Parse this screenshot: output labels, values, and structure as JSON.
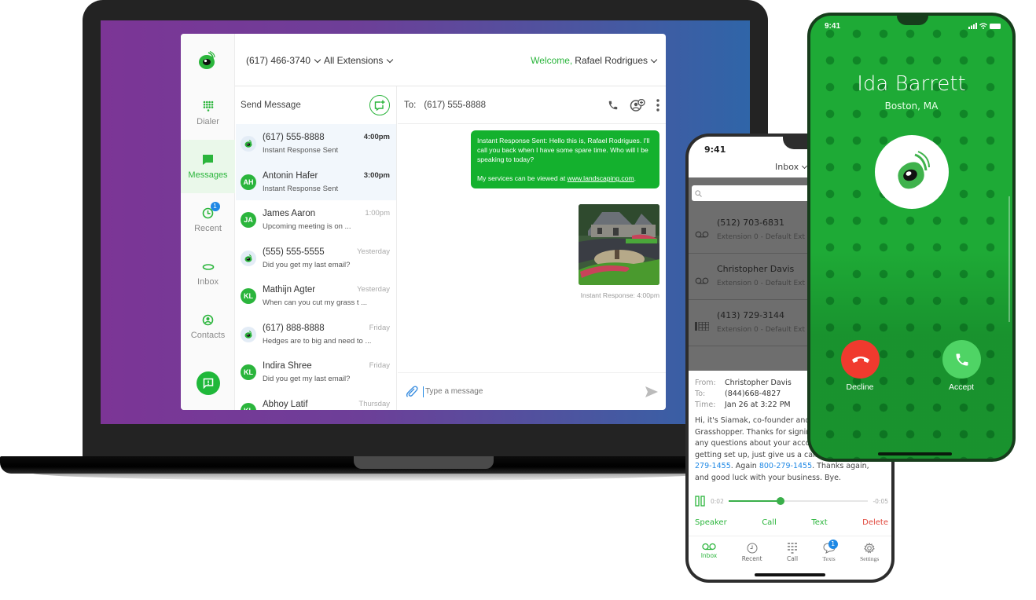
{
  "desktop_app": {
    "header": {
      "phone_number": "(617) 466-3740",
      "extensions": "All Extensions",
      "welcome_prefix": "Welcome,",
      "user_name": "Rafael Rodrigues"
    },
    "nav": [
      {
        "label": "Dialer",
        "icon": "dialpad-icon"
      },
      {
        "label": "Messages",
        "icon": "message-icon",
        "active": true
      },
      {
        "label": "Recent",
        "icon": "clock-icon",
        "badge": "1"
      },
      {
        "label": "Inbox",
        "icon": "voicemail-icon"
      },
      {
        "label": "Contacts",
        "icon": "contact-icon"
      }
    ],
    "feedback_icon": "feedback-icon",
    "list": {
      "title": "Send Message",
      "conversations": [
        {
          "avatar": "logo",
          "name": "(617) 555-8888",
          "preview": "Instant Response Sent",
          "time": "4:00pm",
          "bold_time": true,
          "selected": true
        },
        {
          "avatar": "AH",
          "name": "Antonin Hafer",
          "preview": "Instant Response Sent",
          "time": "3:00pm",
          "bold_time": true,
          "selected": true
        },
        {
          "avatar": "JA",
          "name": "James Aaron",
          "preview": "Upcoming meeting is on ...",
          "time": "1:00pm"
        },
        {
          "avatar": "logo",
          "name": "(555) 555-5555",
          "preview": "Did you get my last email?",
          "time": "Yesterday"
        },
        {
          "avatar": "KL",
          "name": "Mathijn Agter",
          "preview": "When can you cut my grass t ...",
          "time": "Yesterday"
        },
        {
          "avatar": "logo",
          "name": "(617) 888-8888",
          "preview": "Hedges are to big and need to ...",
          "time": "Friday"
        },
        {
          "avatar": "KL",
          "name": "Indira Shree",
          "preview": "Did you get my last email?",
          "time": "Friday"
        },
        {
          "avatar": "KL",
          "name": "Abhoy Latif",
          "preview": "",
          "time": "Thursday"
        }
      ]
    },
    "chat": {
      "to_label": "To:",
      "to_number": "(617) 555-8888",
      "message_text": "Instant Response Sent: Hello this is, Rafael Rodrigues. I'll call you back when I have some spare time. Who will I be speaking to today?",
      "message_services_prefix": "My services can be viewed at ",
      "message_link": "www.landscaping.com",
      "message_services_suffix": ".",
      "image_caption": "Instant Response: 4:00pm",
      "compose_placeholder": "Type a message"
    }
  },
  "inbox_phone": {
    "time": "9:41",
    "title": "Inbox",
    "items": [
      {
        "icon": "voicemail-icon",
        "title": "(512) 703-6831",
        "subtitle": "Extension 0 - Default Ext"
      },
      {
        "icon": "voicemail-icon",
        "title": "Christopher Davis",
        "subtitle": "Extension 0 - Default Ext"
      },
      {
        "icon": "fax-icon",
        "title": "(413) 729-3144",
        "subtitle": "Extension 0 - Default Ext"
      }
    ],
    "detail": {
      "from_label": "From:",
      "from": "Christopher Davis",
      "to_label": "To:",
      "to": "(844)668-4827",
      "time_label": "Time:",
      "time": "Jan 26 at 3:22 PM",
      "body_1": "Hi, it's Siamak, co-founder and CEO of Grasshopper. Thanks for signing up. If you have any questions about your account or need help getting set up, just give us a call, 24/7, at ",
      "body_link_1": "800-279-1455",
      "body_2": ". Again ",
      "body_link_2": "800-279-1455",
      "body_3": ". Thanks again, and good luck with your business. Bye."
    },
    "player": {
      "elapsed": "0:02",
      "remaining": "-0:05",
      "progress": 0.37
    },
    "actions": {
      "speaker": "Speaker",
      "call": "Call",
      "text": "Text",
      "delete": "Delete"
    },
    "tabs": [
      {
        "label": "Inbox",
        "icon": "voicemail-icon",
        "active": true
      },
      {
        "label": "Recent",
        "icon": "clock-icon"
      },
      {
        "label": "Call",
        "icon": "dialpad-icon"
      },
      {
        "label": "Texts",
        "icon": "chat-bubble-icon",
        "badge": "1"
      },
      {
        "label": "Settings",
        "icon": "gear-icon"
      }
    ]
  },
  "call_phone": {
    "time": "9:41",
    "caller_name": "Ida Barrett",
    "caller_location": "Boston, MA",
    "decline_label": "Decline",
    "accept_label": "Accept"
  },
  "colors": {
    "brand_green": "#2bb53c",
    "bubble_green": "#14b12e",
    "decline_red": "#f03a2e",
    "accept_green": "#4fd465",
    "badge_blue": "#1e88e5"
  }
}
